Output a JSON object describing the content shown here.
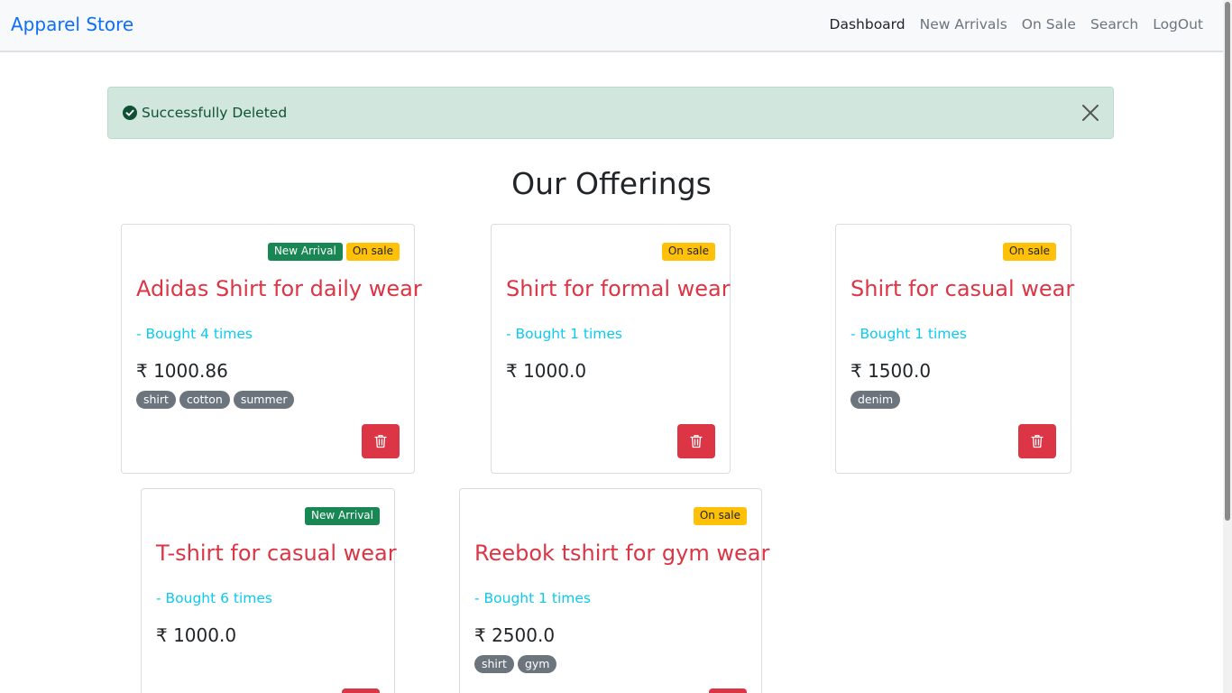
{
  "brand": "Apparel Store",
  "nav": [
    {
      "label": "Dashboard",
      "active": true
    },
    {
      "label": "New Arrivals",
      "active": false
    },
    {
      "label": "On Sale",
      "active": false
    },
    {
      "label": "Search",
      "active": false
    },
    {
      "label": "LogOut",
      "active": false
    }
  ],
  "alert": {
    "message": "Successfully Deleted",
    "icon": "check-circle-icon",
    "close_icon": "close-icon",
    "color": "#d1e7dd"
  },
  "heading": "Our Offerings",
  "products": [
    {
      "title": "Adidas Shirt for daily wear",
      "bought": "- Bought 4 times",
      "price": "₹ 1000.86",
      "badges": [
        "New Arrival",
        "On sale"
      ],
      "tags": [
        "shirt",
        "cotton",
        "summer"
      ]
    },
    {
      "title": "Shirt for formal wear",
      "bought": "- Bought 1 times",
      "price": "₹ 1000.0",
      "badges": [
        "On sale"
      ],
      "tags": []
    },
    {
      "title": "Shirt for casual wear",
      "bought": "- Bought 1 times",
      "price": "₹ 1500.0",
      "badges": [
        "On sale"
      ],
      "tags": [
        "denim"
      ]
    },
    {
      "title": "T-shirt for casual wear",
      "bought": "- Bought 6 times",
      "price": "₹ 1000.0",
      "badges": [
        "New Arrival"
      ],
      "tags": []
    },
    {
      "title": "Reebok tshirt for gym wear",
      "bought": "- Bought 1 times",
      "price": "₹ 2500.0",
      "badges": [
        "On sale"
      ],
      "tags": [
        "shirt",
        "gym"
      ]
    }
  ],
  "colors": {
    "brand": "#0d6efd",
    "title": "#dc3545",
    "bought": "#0dcaf0",
    "new_badge": "#198754",
    "sale_badge": "#ffc107",
    "tag": "#6c757d",
    "delete": "#dc3545"
  }
}
